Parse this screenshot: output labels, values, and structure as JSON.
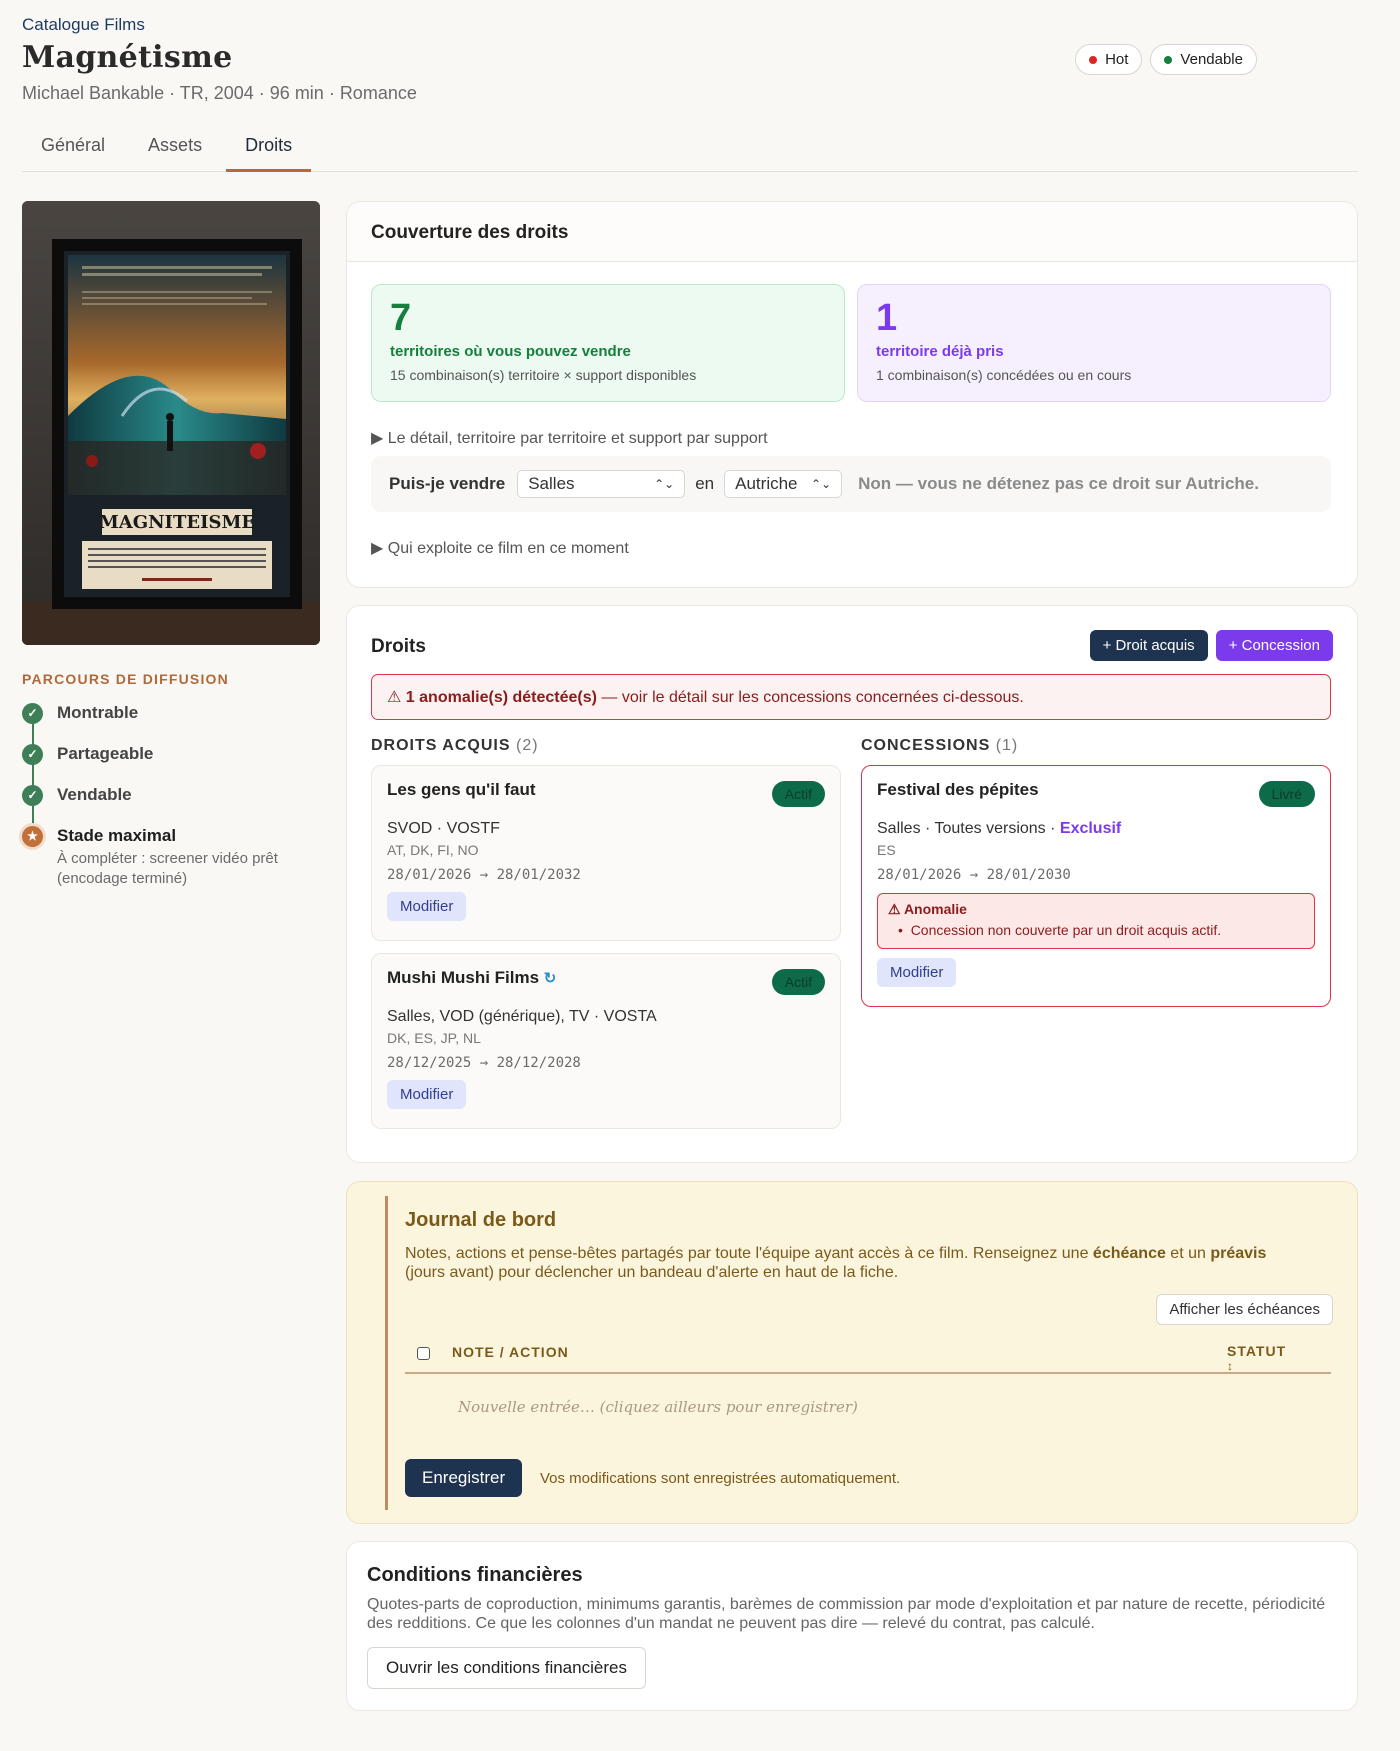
{
  "header": {
    "breadcrumb": "Catalogue Films",
    "title": "Magnétisme",
    "subtitle": "Michael Bankable · TR, 2004 · 96 min · Romance",
    "badges": [
      {
        "label": "Hot",
        "color": "#dc2626"
      },
      {
        "label": "Vendable",
        "color": "#15803d"
      }
    ]
  },
  "tabs": [
    "Général",
    "Assets",
    "Droits"
  ],
  "active_tab": "Droits",
  "poster": {
    "title": "MAGNITEISME"
  },
  "sidebar": {
    "heading": "PARCOURS DE DIFFUSION",
    "steps": [
      {
        "label": "Montrable",
        "status": "done"
      },
      {
        "label": "Partageable",
        "status": "done"
      },
      {
        "label": "Vendable",
        "status": "done"
      },
      {
        "label": "Stade maximal",
        "status": "star",
        "note": "À compléter : screener vidéo prêt (encodage terminé)"
      }
    ]
  },
  "coverage": {
    "title": "Couverture des droits",
    "sell": {
      "count": "7",
      "label": "territoires où vous pouvez vendre",
      "sub": "15 combinaison(s) territoire × support disponibles"
    },
    "taken": {
      "count": "1",
      "label": "territoire déjà pris",
      "sub": "1 combinaison(s) concédées ou en cours"
    },
    "detail_toggle": "Le détail, territoire par territoire et support par support",
    "query": {
      "label": "Puis-je vendre",
      "support": "Salles",
      "en": "en",
      "territory": "Autriche",
      "answer": "Non — vous ne détenez pas ce droit sur Autriche."
    },
    "exploit_toggle": "Qui exploite ce film en ce moment"
  },
  "rights": {
    "title": "Droits",
    "btn_acquis": "+ Droit acquis",
    "btn_concession": "+ Concession",
    "alert_strong": "1 anomalie(s) détectée(s)",
    "alert_rest": " — voir le détail sur les concessions concernées ci-dessous.",
    "acquis_head": "DROITS ACQUIS",
    "acquis_count": "(2)",
    "conc_head": "CONCESSIONS",
    "conc_count": "(1)",
    "acquis": [
      {
        "name": "Les gens qu'il faut",
        "status": "Actif",
        "media": "SVOD · VOSTF",
        "territories": "AT, DK, FI, NO",
        "dates": "28/01/2026 → 28/01/2032",
        "modify": "Modifier"
      },
      {
        "name": "Mushi Mushi Films",
        "status": "Actif",
        "media": "Salles, VOD (générique), TV · VOSTA",
        "territories": "DK, ES, JP, NL",
        "dates": "28/12/2025 → 28/12/2028",
        "modify": "Modifier"
      }
    ],
    "concessions": [
      {
        "name": "Festival des pépites",
        "status": "Livré",
        "media": "Salles · Toutes versions · ",
        "exclusive": "Exclusif",
        "territories": "ES",
        "dates": "28/01/2026 → 28/01/2030",
        "anomaly_title": "Anomalie",
        "anomaly_item": "Concession non couverte par un droit acquis actif.",
        "modify": "Modifier"
      }
    ]
  },
  "journal": {
    "title": "Journal de bord",
    "desc_1": "Notes, actions et pense-bêtes partagés par toute l'équipe ayant accès à ce film. Renseignez une ",
    "desc_b1": "échéance",
    "desc_2": " et un ",
    "desc_b2": "préavis",
    "desc_3": "(jours avant) pour déclencher un bandeau d'alerte en haut de la fiche.",
    "show_deadlines": "Afficher les échéances",
    "col_note": "NOTE / ACTION",
    "col_status": "STATUT",
    "sort_icon": "↕",
    "placeholder": "Nouvelle entrée… (cliquez ailleurs pour enregistrer)",
    "save": "Enregistrer",
    "autosave": "Vos modifications sont enregistrées automatiquement."
  },
  "finance": {
    "title": "Conditions financières",
    "desc": "Quotes-parts de coproduction, minimums garantis, barèmes de commission par mode d'exploitation et par nature de recette, périodicité des redditions. Ce que les colonnes d'un mandat ne peuvent pas dire — relevé du contrat, pas calculé.",
    "button": "Ouvrir les conditions financières"
  }
}
